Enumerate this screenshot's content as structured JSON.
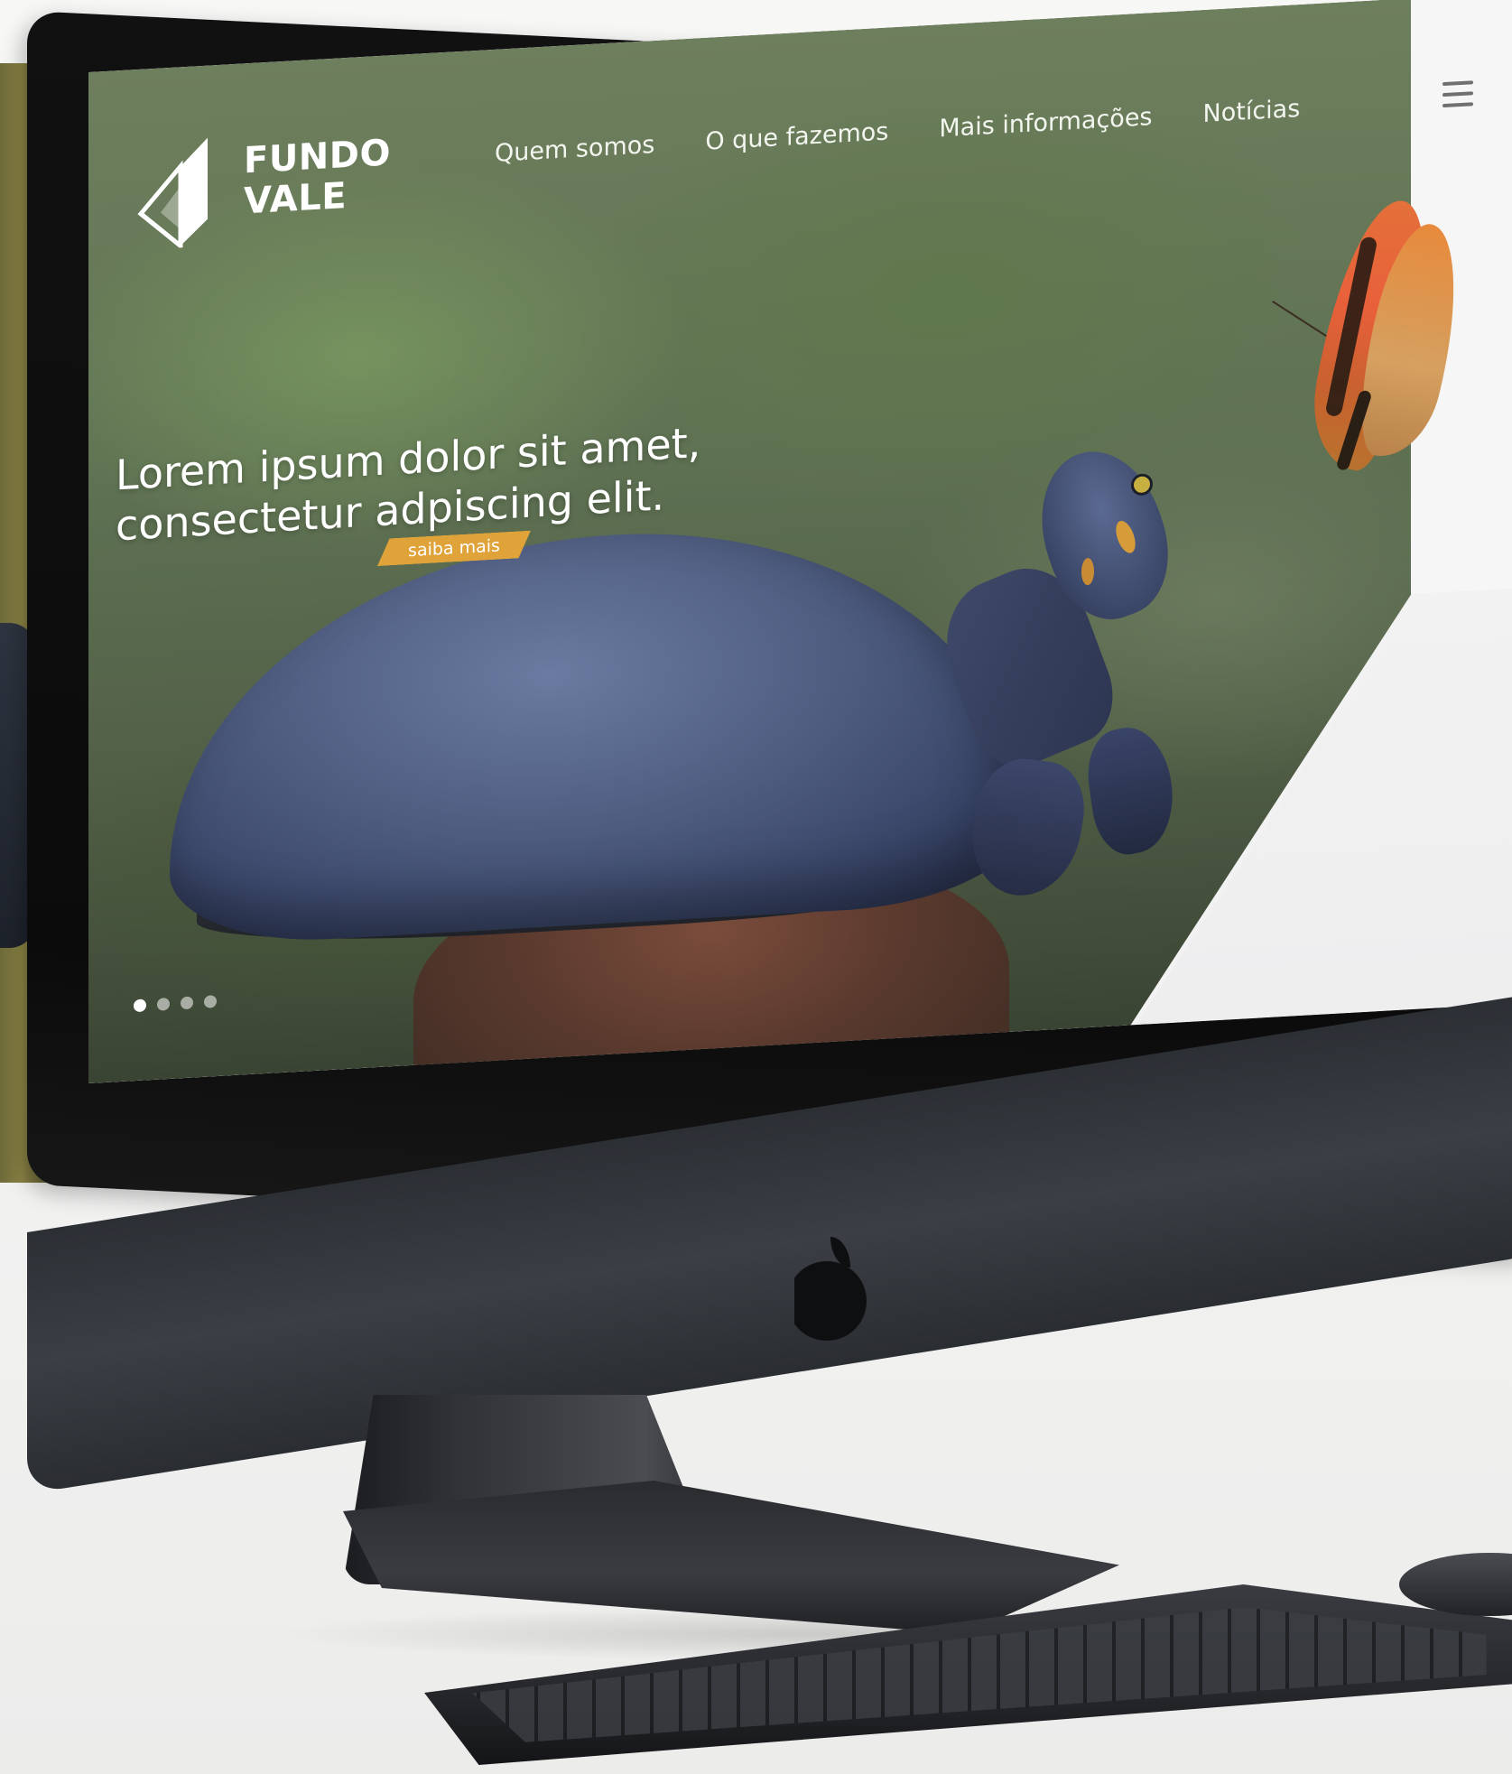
{
  "brand": {
    "line1": "FUNDO",
    "line2": "VALE"
  },
  "nav": {
    "items": [
      {
        "label": "Quem somos"
      },
      {
        "label": "O que fazemos"
      },
      {
        "label": "Mais informações"
      },
      {
        "label": "Notícias"
      }
    ]
  },
  "hero": {
    "headline_line1": "Lorem ipsum dolor sit amet,",
    "headline_line2": "consectetur adpiscing elit.",
    "cta_label": "saiba mais",
    "slides_total": 4,
    "slide_active": 1
  },
  "icons": {
    "menu": "hamburger-menu-icon",
    "logo": "fundo-vale-logo",
    "apple": "apple-logo"
  },
  "colors": {
    "accent": "#e0a33a",
    "nav_text": "#f3f5ef",
    "menu_icon": "#707070"
  }
}
